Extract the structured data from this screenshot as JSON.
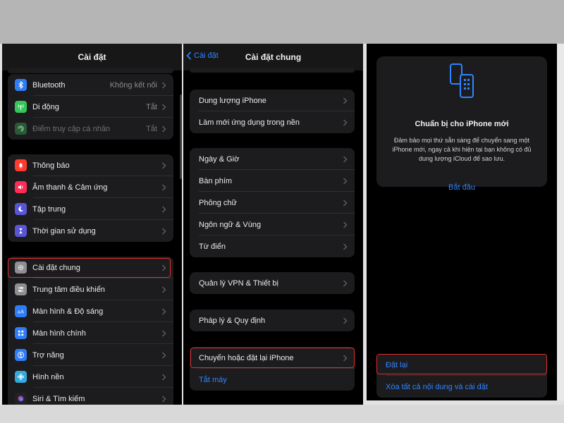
{
  "colors": {
    "accent": "#2f84ff",
    "highlight": "#e0302a",
    "background": "#000000",
    "cell": "#1c1c1e"
  },
  "panel1": {
    "title": "Cài đặt",
    "group1": [
      {
        "label": "Bluetooth",
        "value": "Không kết nối",
        "icon": "bluetooth-icon",
        "color": "#2f7df6"
      },
      {
        "label": "Di động",
        "value": "Tắt",
        "icon": "antenna-icon",
        "color": "#34c759"
      },
      {
        "label": "Điểm truy cập cá nhân",
        "value": "Tắt",
        "icon": "hotspot-icon",
        "color": "#34c759"
      }
    ],
    "group2": [
      {
        "label": "Thông báo",
        "icon": "bell-icon",
        "color": "#ff3b30"
      },
      {
        "label": "Âm thanh & Cảm ứng",
        "icon": "speaker-icon",
        "color": "#ff2d55"
      },
      {
        "label": "Tập trung",
        "icon": "moon-icon",
        "color": "#5856d6"
      },
      {
        "label": "Thời gian sử dụng",
        "icon": "hourglass-icon",
        "color": "#5856d6"
      }
    ],
    "group3": [
      {
        "label": "Cài đặt chung",
        "icon": "gear-icon",
        "color": "#8e8e93"
      },
      {
        "label": "Trung tâm điều khiển",
        "icon": "toggles-icon",
        "color": "#8e8e93"
      },
      {
        "label": "Màn hình & Độ sáng",
        "icon": "text-size-icon",
        "color": "#2f7df6"
      },
      {
        "label": "Màn hình chính",
        "icon": "home-grid-icon",
        "color": "#2f7df6"
      },
      {
        "label": "Trợ năng",
        "icon": "accessibility-icon",
        "color": "#2f7df6"
      },
      {
        "label": "Hình nền",
        "icon": "flower-icon",
        "color": "#35a8dc"
      },
      {
        "label": "Siri & Tìm kiếm",
        "icon": "siri-icon",
        "color": "#222222"
      }
    ]
  },
  "panel2": {
    "back": "Cài đặt",
    "title": "Cài đặt chung",
    "group1": [
      "Dung lượng iPhone",
      "Làm mới ứng dụng trong nền"
    ],
    "group2": [
      "Ngày & Giờ",
      "Bàn phím",
      "Phông chữ",
      "Ngôn ngữ & Vùng",
      "Từ điển"
    ],
    "group3": [
      "Quản lý VPN & Thiết bị"
    ],
    "group4": [
      "Pháp lý & Quy định"
    ],
    "group5": [
      "Chuyển hoặc đặt lại iPhone"
    ],
    "shutdown": "Tắt máy"
  },
  "panel3": {
    "card": {
      "icon": "phones-transfer-icon",
      "title": "Chuẩn bị cho iPhone mới",
      "description": "Đảm bảo mọi thứ sẵn sàng để chuyển sang một iPhone mới, ngay cả khi hiện tại bạn không có đủ dung lượng iCloud để sao lưu.",
      "link": "Bắt đầu"
    },
    "actions": [
      "Đặt lại",
      "Xóa tất cả nội dung và cài đặt"
    ]
  }
}
